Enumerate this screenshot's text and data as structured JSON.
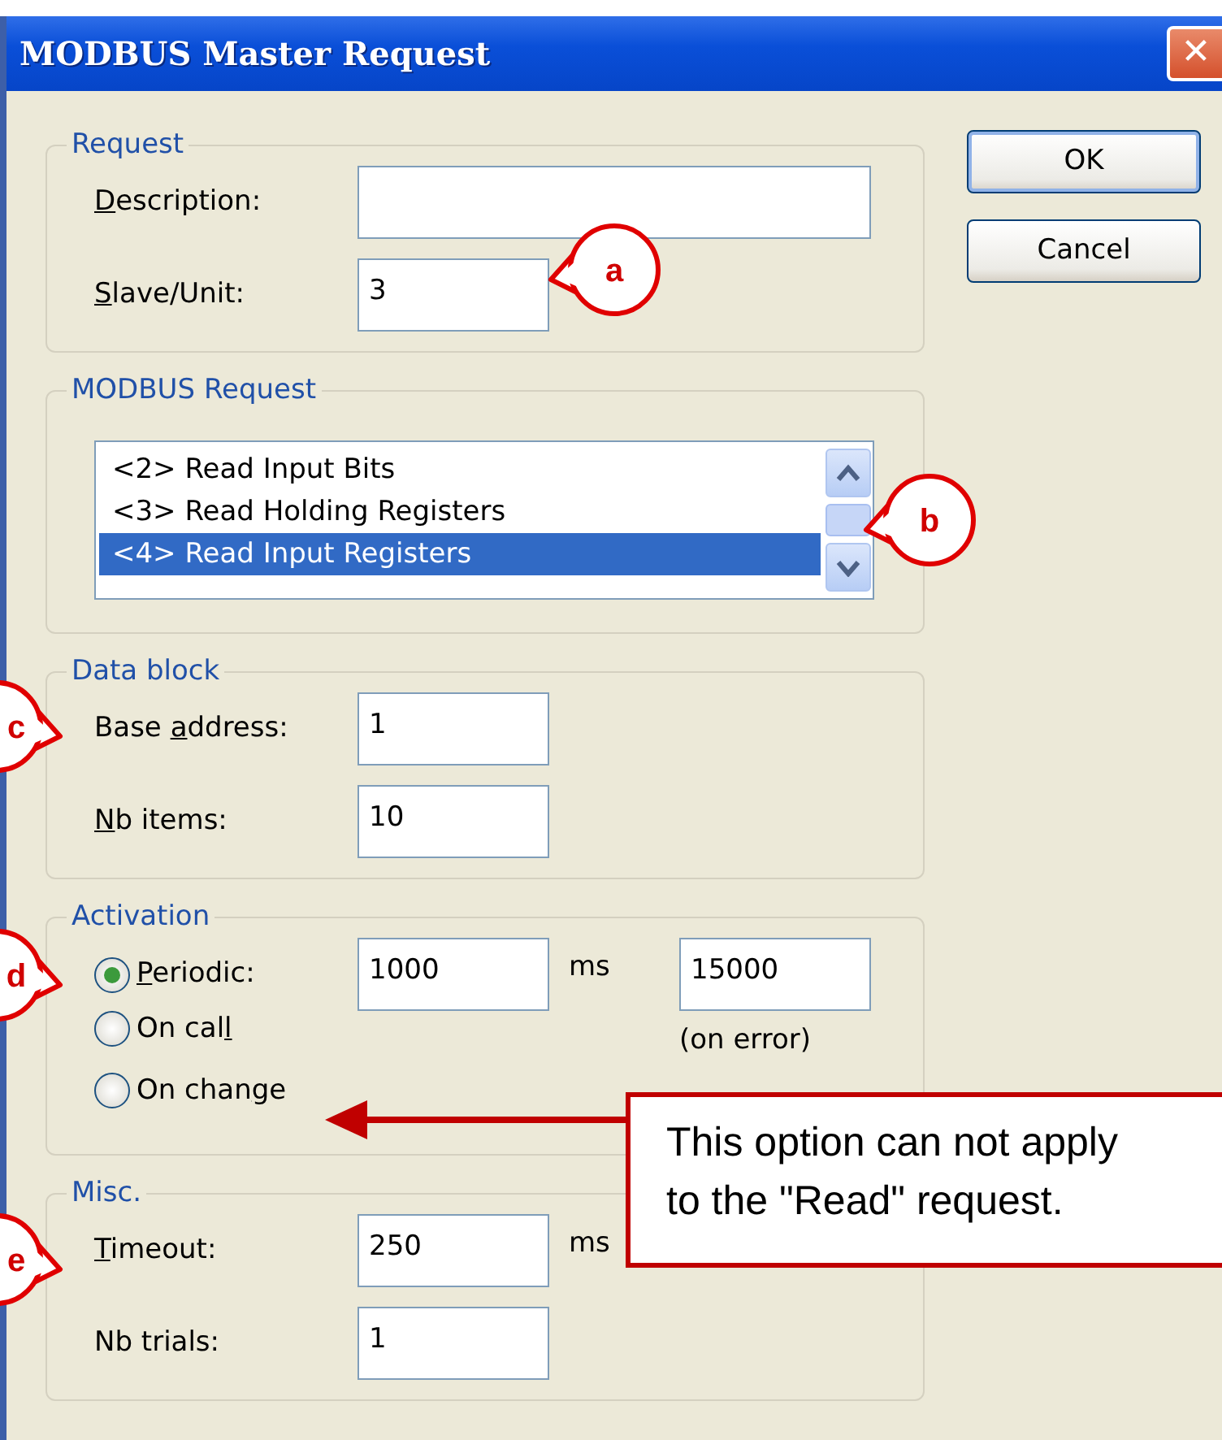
{
  "window": {
    "title": "MODBUS Master Request",
    "close": "✕"
  },
  "buttons": [
    {
      "label": "OK",
      "default": true
    },
    {
      "label": "Cancel",
      "default": false
    }
  ],
  "request": {
    "legend": "Request",
    "fields": [
      {
        "kind": "long",
        "accel": "D",
        "post": "escription:"
      },
      {
        "kind": "short",
        "accel": "S",
        "post": "lave/Unit:",
        "value": "3"
      }
    ]
  },
  "modbus_request": {
    "legend": "MODBUS Request",
    "items": [
      {
        "text": "<2> Read Input Bits",
        "selected": false
      },
      {
        "text": "<3> Read Holding Registers",
        "selected": false
      },
      {
        "text": "<4> Read Input Registers",
        "selected": true
      }
    ]
  },
  "data_block": {
    "legend": "Data block",
    "fields": [
      {
        "kind": "short",
        "pre": "Base ",
        "accel": "a",
        "post": "ddress:",
        "value": "1"
      },
      {
        "kind": "short",
        "accel": "N",
        "post": "b items:",
        "value": "10"
      }
    ]
  },
  "activation": {
    "legend": "Activation",
    "options": [
      {
        "accel": "P",
        "post": "eriodic:",
        "selected": true,
        "value": "1000",
        "unit": "ms",
        "extra_value": "15000",
        "extra_caption": "(on error)"
      },
      {
        "pre": "On cal",
        "accel": "l",
        "selected": false
      },
      {
        "pre": "On chan",
        "accel": "g",
        "post": "e",
        "selected": false
      }
    ]
  },
  "misc": {
    "legend": "Misc.",
    "fields": [
      {
        "kind": "short",
        "accel": "T",
        "post": "imeout:",
        "value": "250",
        "unit": "ms"
      },
      {
        "kind": "short",
        "pre": "Nb trials:",
        "value": "1"
      }
    ]
  },
  "callouts": [
    {
      "letter": "a"
    },
    {
      "letter": "b"
    },
    {
      "letter": "c"
    },
    {
      "letter": "d"
    },
    {
      "letter": "e"
    }
  ],
  "note": {
    "text": "This option can not apply to the \"Read\" request."
  }
}
